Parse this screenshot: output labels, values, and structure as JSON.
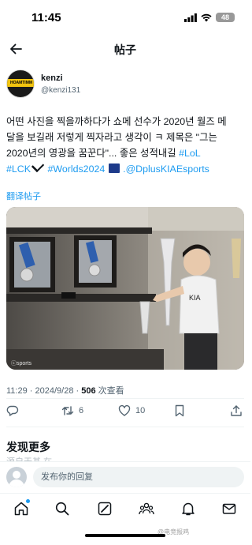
{
  "status": {
    "time": "11:45",
    "battery": "48"
  },
  "nav": {
    "title": "帖子"
  },
  "author": {
    "name": "kenzi",
    "handle": "@kenzi131",
    "avatar_text": "HOAMTIMM"
  },
  "tweet": {
    "line1": "어떤 사진을 찍을까하다가 쇼메 선수가 2020년 월즈 메",
    "line2": "달을 보길래 저렇게 찍자라고 생각이 ㅋ 제목은 \"그는",
    "line3_pre": "2020년의 영광을 꿈꾼다\"... 좋은 성적내길 ",
    "tag_lol": "#LoL",
    "tag_lck": "#LCK",
    "tag_worlds": "#Worlds2024",
    "mention": ".@DplusKIAEsports",
    "translate": "翻译帖子"
  },
  "photo": {
    "credit": "ⓒsports"
  },
  "meta": {
    "time": "11:29",
    "date": "2024/9/28",
    "views": "506",
    "views_label": "次查看"
  },
  "actions": {
    "retweets": "6",
    "likes": "10"
  },
  "discover": {
    "title": "发现更多",
    "sub": "源自于基 在"
  },
  "reply": {
    "placeholder": "发布你的回复"
  },
  "watermark": "@电竞报鸡",
  "colors": {
    "accent": "#1d9bf0",
    "text": "#0f1419",
    "secondary": "#536471"
  }
}
